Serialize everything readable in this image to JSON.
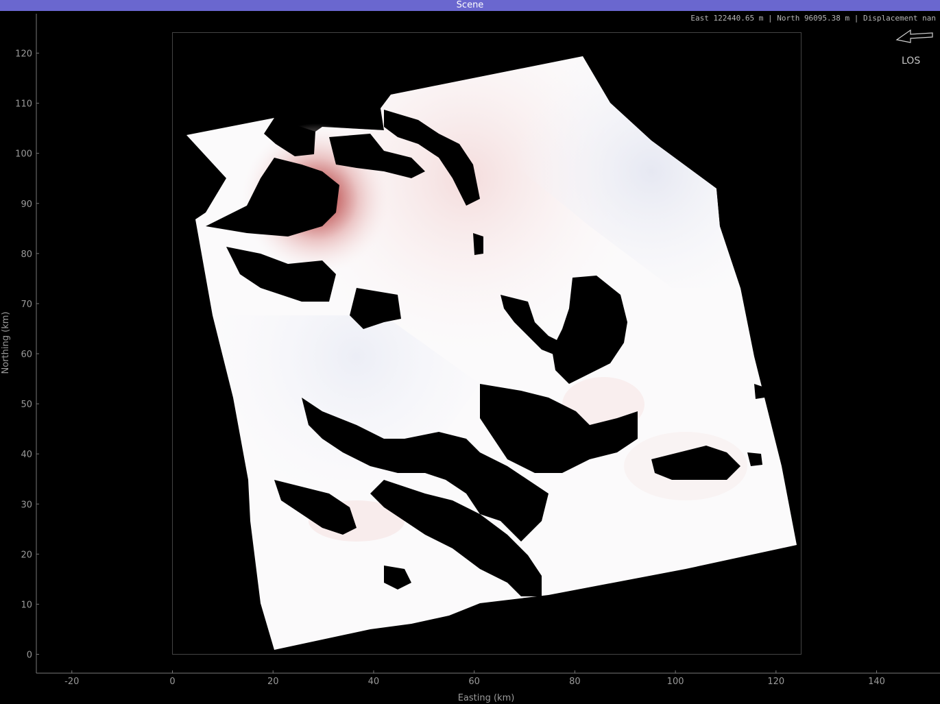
{
  "window": {
    "title": "Scene"
  },
  "status": {
    "readout": "East 122440.65 m | North 96095.38 m | Displacement nan"
  },
  "los": {
    "label": "LOS"
  },
  "colors": {
    "titlebar": "#6a67cf",
    "background": "#000000",
    "axis": "#9a9a9a",
    "uplift": "#b03030",
    "neutral": "#ffffff",
    "subsidence": "#d8dbe8"
  },
  "chart_data": {
    "type": "heatmap",
    "title": "",
    "xlabel": "Easting (km)",
    "ylabel": "Northing (km)",
    "xlim": [
      -27,
      150
    ],
    "ylim": [
      -4,
      124
    ],
    "x_ticks": [
      -20,
      0,
      20,
      40,
      60,
      80,
      100,
      120,
      140
    ],
    "y_ticks": [
      0,
      10,
      20,
      30,
      40,
      50,
      60,
      70,
      80,
      90,
      100,
      110,
      120
    ],
    "x_tick_labels": [
      "-20",
      "0",
      "20",
      "40",
      "60",
      "80",
      "100",
      "120",
      "140"
    ],
    "y_tick_labels": [
      "0",
      "10",
      "20",
      "30",
      "40",
      "50",
      "60",
      "70",
      "80",
      "90",
      "100",
      "110",
      "120"
    ],
    "scene_frame": {
      "x": [
        0,
        125
      ],
      "y": [
        0,
        124
      ]
    },
    "grid": false
  }
}
